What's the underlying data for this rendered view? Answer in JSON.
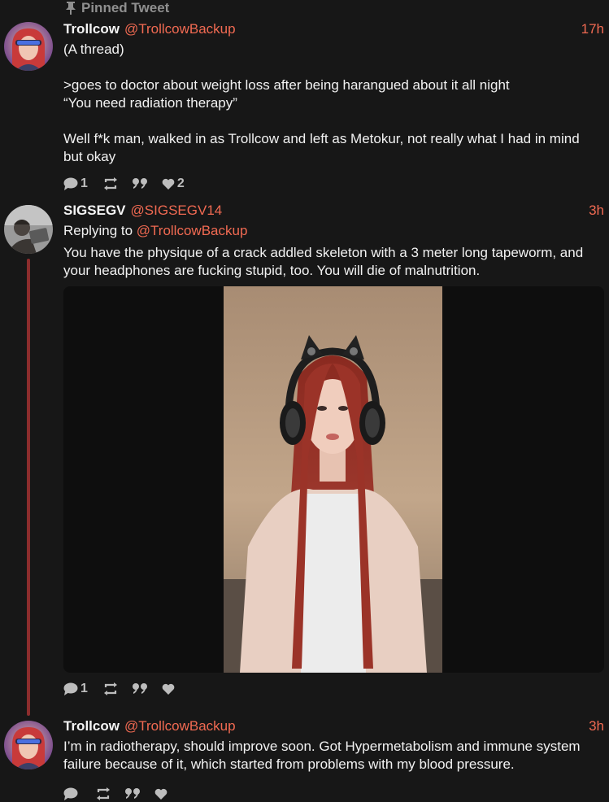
{
  "pinned_label": "Pinned Tweet",
  "tweets": [
    {
      "name": "Trollcow",
      "handle": "@TrollcowBackup",
      "time": "17h",
      "lines": [
        "(A thread)",
        "",
        ">goes to doctor about weight loss after being harangued about it all night",
        "“You need radiation therapy”",
        "",
        "Well f*k man, walked in as Trollcow and left as Metokur, not really what I had in mind",
        "but okay"
      ],
      "reply_count": "1",
      "like_count": "2"
    },
    {
      "name": "SIGSEGV",
      "handle": "@SIGSEGV14",
      "time": "3h",
      "replying_prefix": "Replying to ",
      "replying_handle": "@TrollcowBackup",
      "lines": [
        "You have the physique of a crack addled skeleton with a 3 meter long tapeworm, and",
        "your headphones are fucking stupid, too. You will die of malnutrition."
      ],
      "reply_count": "1",
      "like_count": ""
    },
    {
      "name": "Trollcow",
      "handle": "@TrollcowBackup",
      "time": "3h",
      "lines": [
        "I’m in radiotherapy, should improve soon. Got Hypermetabolism and immune system",
        "failure because of it, which started from problems with my blood pressure."
      ],
      "reply_count": "",
      "like_count": ""
    }
  ],
  "icons": {
    "pin": "pin-icon",
    "reply": "reply-bubble-icon",
    "retweet": "retweet-icon",
    "quote": "quote-icon",
    "like": "heart-icon"
  },
  "colors": {
    "background": "#171717",
    "accent": "#f16a52",
    "thread_line": "#8c2d2d",
    "muted": "#bdbdbd"
  }
}
